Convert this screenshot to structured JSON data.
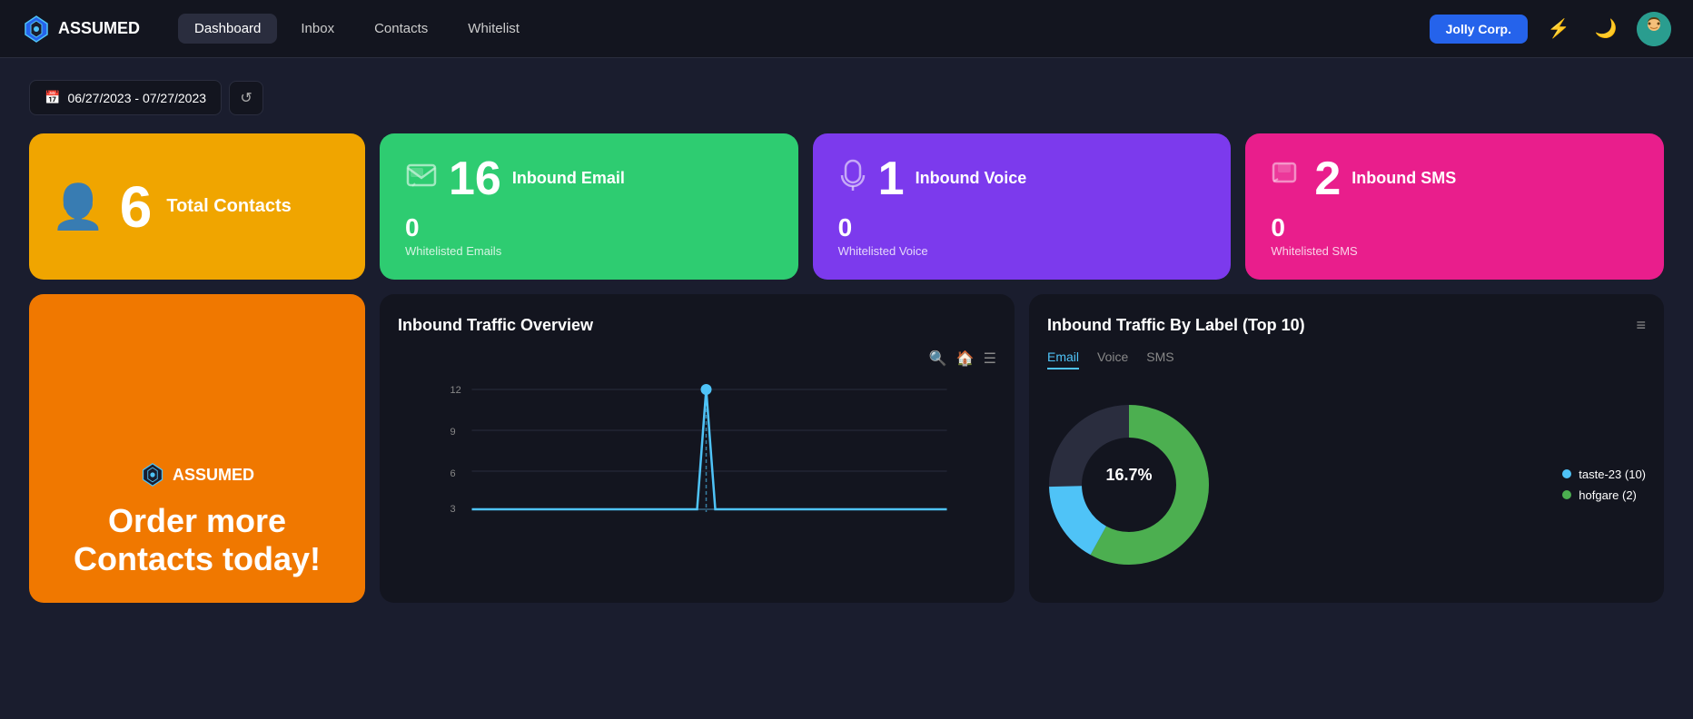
{
  "app": {
    "name": "ASSUMED",
    "logo_unicode": "◈"
  },
  "nav": {
    "items": [
      {
        "label": "Dashboard",
        "active": true
      },
      {
        "label": "Inbox",
        "active": false
      },
      {
        "label": "Contacts",
        "active": false
      },
      {
        "label": "Whitelist",
        "active": false
      }
    ],
    "corp_button": "Jolly Corp.",
    "lightning_icon": "⚡",
    "moon_icon": "🌙"
  },
  "date_range": {
    "value": "06/27/2023 - 07/27/2023",
    "calendar_icon": "📅"
  },
  "stats": {
    "total_contacts": {
      "number": "6",
      "label": "Total Contacts"
    },
    "inbound_email": {
      "number": "16",
      "label": "Inbound Email",
      "sub_number": "0",
      "sub_label": "Whitelisted Emails"
    },
    "inbound_voice": {
      "number": "1",
      "label": "Inbound Voice",
      "sub_number": "0",
      "sub_label": "Whitelisted Voice"
    },
    "inbound_sms": {
      "number": "2",
      "label": "Inbound SMS",
      "sub_number": "0",
      "sub_label": "Whitelisted SMS"
    }
  },
  "promo": {
    "logo_text": "ASSUMED",
    "text": "Order more Contacts today!"
  },
  "traffic_overview": {
    "title": "Inbound Traffic Overview",
    "y_labels": [
      "12",
      "9"
    ],
    "icons": {
      "zoom": "🔍",
      "home": "🏠",
      "menu": "☰"
    }
  },
  "traffic_by_label": {
    "title": "Inbound Traffic By Label (Top 10)",
    "tabs": [
      "Email",
      "Voice",
      "SMS"
    ],
    "active_tab": "Email",
    "donut_label": "16.7%",
    "legend": [
      {
        "label": "taste-23 (10)",
        "color": "#4fc3f7"
      },
      {
        "label": "hofgare (2)",
        "color": "#4caf50"
      }
    ],
    "menu_icon": "≡"
  },
  "colors": {
    "contacts_bg": "#f0a500",
    "email_bg": "#2ecc71",
    "voice_bg": "#7c3aed",
    "sms_bg": "#e91e8c",
    "promo_bg": "#f07800",
    "nav_active": "#2563eb",
    "donut_blue": "#4fc3f7",
    "donut_green": "#4caf50",
    "donut_bg": "#2a2d3e"
  }
}
